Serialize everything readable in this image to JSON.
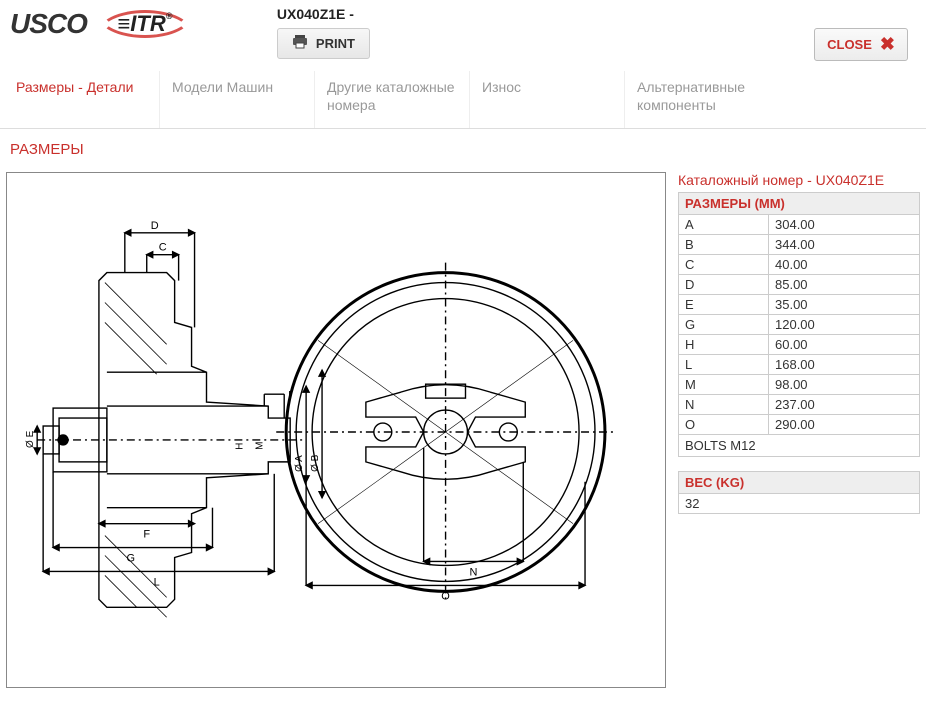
{
  "header": {
    "logo_usco": "USCO",
    "logo_itr": "ITR",
    "part_title": "UX040Z1E -",
    "print_label": "PRINT",
    "close_label": "CLOSE"
  },
  "tabs": [
    {
      "label": "Размеры - Детали",
      "active": true
    },
    {
      "label": "Модели Машин",
      "active": false
    },
    {
      "label": "Другие каталожные номера",
      "active": false
    },
    {
      "label": "Износ",
      "active": false
    },
    {
      "label": "Альтернативные компоненты",
      "active": false
    }
  ],
  "section_title": "РАЗМЕРЫ",
  "catalog": {
    "label": "Каталожный номер - ",
    "value": "UX040Z1E"
  },
  "dimensions": {
    "header": "РАЗМЕРЫ (MM)",
    "rows": [
      {
        "k": "A",
        "v": "304.00"
      },
      {
        "k": "B",
        "v": "344.00"
      },
      {
        "k": "C",
        "v": "40.00"
      },
      {
        "k": "D",
        "v": "85.00"
      },
      {
        "k": "E",
        "v": "35.00"
      },
      {
        "k": "G",
        "v": "120.00"
      },
      {
        "k": "H",
        "v": "60.00"
      },
      {
        "k": "L",
        "v": "168.00"
      },
      {
        "k": "M",
        "v": "98.00"
      },
      {
        "k": "N",
        "v": "237.00"
      },
      {
        "k": "O",
        "v": "290.00"
      }
    ],
    "bolts": "BOLTS M12"
  },
  "weight": {
    "header": "ВЕС (KG)",
    "value": "32"
  },
  "drawing_labels": {
    "D": "D",
    "C": "C",
    "I": "I",
    "H": "H",
    "M": "M",
    "phiE": "Ø E",
    "phiA": "Ø A",
    "phiB": "Ø B",
    "F": "F",
    "G": "G",
    "L": "L",
    "N": "N",
    "O": "O"
  }
}
